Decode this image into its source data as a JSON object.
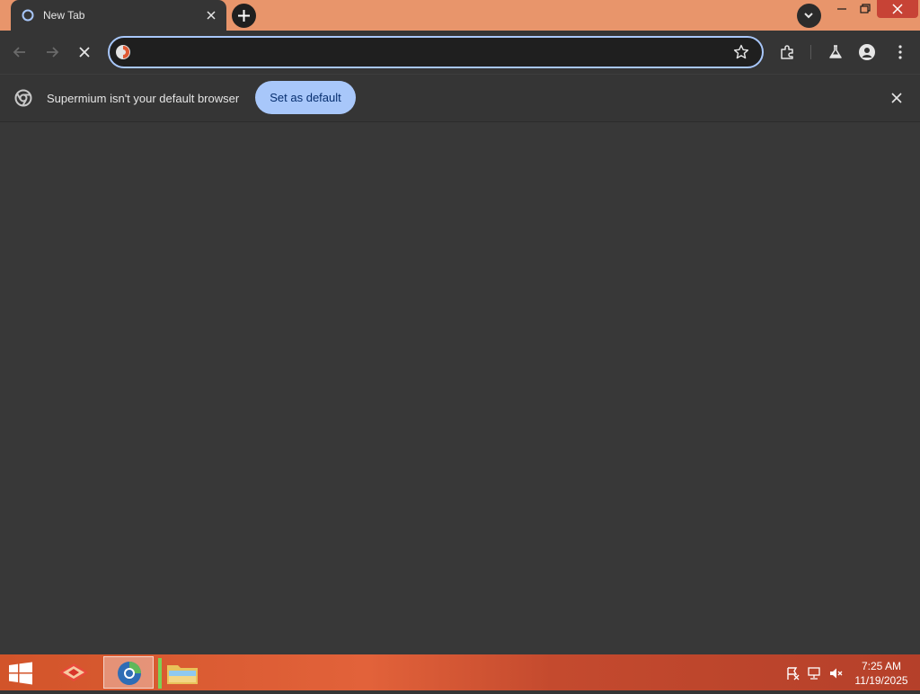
{
  "tab": {
    "title": "New Tab"
  },
  "omnibox": {
    "value": "",
    "placeholder": ""
  },
  "infobar": {
    "message": "Supermium isn't your default browser",
    "button_label": "Set as default"
  },
  "taskbar": {
    "time": "7:25 AM",
    "date": "11/19/2025"
  },
  "colors": {
    "tabstrip": "#e8956b",
    "page_bg": "#383838",
    "accent": "#a8c7fa",
    "close_red": "#c74336"
  }
}
